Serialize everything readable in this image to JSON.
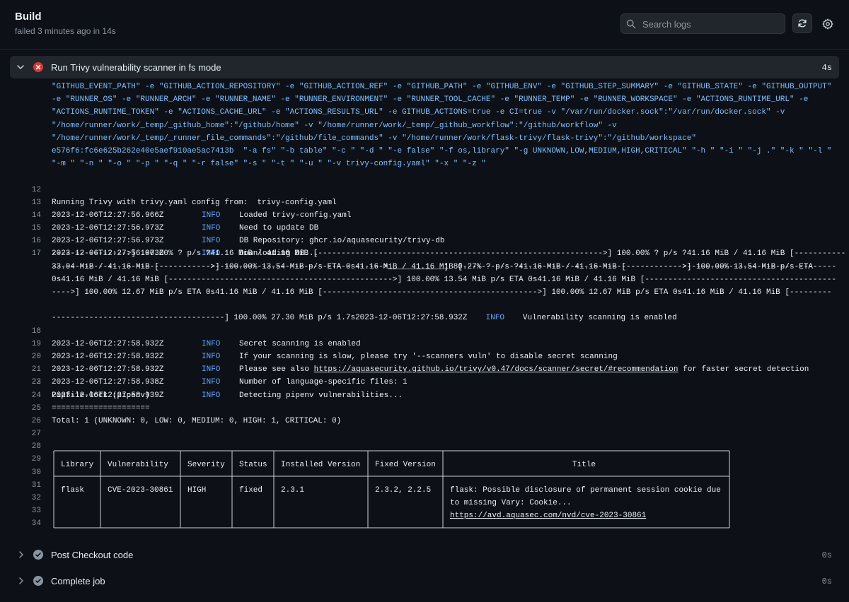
{
  "header": {
    "title": "Build",
    "subtitle": "failed 3 minutes ago in 14s",
    "search_placeholder": "Search logs"
  },
  "icons": {
    "search": "search-icon",
    "refresh": "refresh-icon",
    "settings": "gear-icon",
    "failed": "x-circle-icon",
    "success": "check-circle-icon"
  },
  "colors": {
    "failed": "#da3633",
    "success": "#8b949e",
    "info": "#58a6ff",
    "env": "#79c0ff"
  },
  "active_step": {
    "name": "Run Trivy vulnerability scanner in fs mode",
    "duration": "4s",
    "status": "failed"
  },
  "env_lines": [
    "\"GITHUB_EVENT_PATH\" -e \"GITHUB_ACTION_REPOSITORY\" -e \"GITHUB_ACTION_REF\" -e \"GITHUB_PATH\" -e \"GITHUB_ENV\" -e \"GITHUB_STEP_SUMMARY\" -e \"GITHUB_STATE\" -e \"GITHUB_OUTPUT\"",
    "-e \"RUNNER_OS\" -e \"RUNNER_ARCH\" -e \"RUNNER_NAME\" -e \"RUNNER_ENVIRONMENT\" -e \"RUNNER_TOOL_CACHE\" -e \"RUNNER_TEMP\" -e \"RUNNER_WORKSPACE\" -e \"ACTIONS_RUNTIME_URL\" -e",
    "\"ACTIONS_RUNTIME_TOKEN\" -e \"ACTIONS_CACHE_URL\" -e \"ACTIONS_RESULTS_URL\" -e GITHUB_ACTIONS=true -e CI=true -v \"/var/run/docker.sock\":\"/var/run/docker.sock\" -v",
    "\"/home/runner/work/_temp/_github_home\":\"/github/home\" -v \"/home/runner/work/_temp/_github_workflow\":\"/github/workflow\" -v",
    "\"/home/runner/work/_temp/_runner_file_commands\":\"/github/file_commands\" -v \"/home/runner/work/flask-trivy/flask-trivy\":\"/github/workspace\"",
    "e576f6:fc6e625b262e40e5aef910ae5ac7413b  \"-a fs\" \"-b table\" \"-c \" \"-d \" \"-e false\" \"-f os,library\" \"-g UNKNOWN,LOW,MEDIUM,HIGH,CRITICAL\" \"-h \" \"-i \" \"-j .\" \"-k \" \"-l \"",
    "\"-m \" \"-n \" \"-o \" \"-p \" \"-q \" \"-r false\" \"-s \" \"-t \" \"-u \" \"-v trivy-config.yaml\" \"-x \" \"-z \""
  ],
  "lines": [
    {
      "n": "12",
      "text": "Running Trivy with trivy.yaml config from:  trivy-config.yaml"
    },
    {
      "n": "13",
      "ts": "2023-12-06T12:27:56.966Z",
      "level": "INFO",
      "msg": "Loaded trivy-config.yaml"
    },
    {
      "n": "14",
      "ts": "2023-12-06T12:27:56.973Z",
      "level": "INFO",
      "msg": "Need to update DB"
    },
    {
      "n": "15",
      "ts": "2023-12-06T12:27:56.973Z",
      "level": "INFO",
      "msg": "DB Repository: ghcr.io/aquasecurity/trivy-db"
    },
    {
      "n": "16",
      "ts": "2023-12-06T12:27:56.973Z",
      "level": "INFO",
      "msg": "Downloading DB..."
    }
  ],
  "progress_line": {
    "n": "17",
    "rows": [
      "33.04 MiB / 41.16 MiB [------------------------------------------------>____________] 80.27% ? p/s ?41.16 MiB / 41.16 MiB [---------------------------------------------",
      "---------------->] 100.00% ? p/s ?41.16 MiB / 41.16 MiB [------------------------------------------------------------->] 100.00% ? p/s ?41.16 MiB / 41.16 MiB [-----------",
      "---------------------------------->] 100.00% 13.54 MiB p/s ETA 0s41.16 MiB / 41.16 MiB [----------------------------------------------->] 100.00% 13.54 MiB p/s ETA",
      "0s41.16 MiB / 41.16 MiB [------------------------------------------------>] 100.00% 13.54 MiB p/s ETA 0s41.16 MiB / 41.16 MiB [-----------------------------------------",
      "---->] 100.00% 12.67 MiB p/s ETA 0s41.16 MiB / 41.16 MiB [---------------------------------------------->] 100.00% 12.67 MiB p/s ETA 0s41.16 MiB / 41.16 MiB [---------",
      "-------------------------------------] 100.00% 27.30 MiB p/s 1.7s"
    ],
    "tail_ts": "2023-12-06T12:27:58.932Z",
    "tail_level": "INFO",
    "tail_msg": "Vulnerability scanning is enabled"
  },
  "lines2": [
    {
      "n": "18",
      "ts": "2023-12-06T12:27:58.932Z",
      "level": "INFO",
      "msg": "Secret scanning is enabled"
    },
    {
      "n": "19",
      "ts": "2023-12-06T12:27:58.932Z",
      "level": "INFO",
      "msg": "If your scanning is slow, please try '--scanners vuln' to disable secret scanning"
    },
    {
      "n": "20",
      "ts": "2023-12-06T12:27:58.932Z",
      "level": "INFO",
      "msg_pre": "Please see also ",
      "link": "https://aquasecurity.github.io/trivy/v0.47/docs/scanner/secret/#recommendation",
      "msg_post": " for faster secret detection"
    },
    {
      "n": "21",
      "ts": "2023-12-06T12:27:58.938Z",
      "level": "INFO",
      "msg": "Number of language-specific files: 1"
    },
    {
      "n": "22",
      "ts": "2023-12-06T12:27:58.939Z",
      "level": "INFO",
      "msg": "Detecting pipenv vulnerabilities..."
    }
  ],
  "plain_lines": [
    {
      "n": "23",
      "text": ""
    },
    {
      "n": "24",
      "text": "Pipfile.lock (pipenv)"
    },
    {
      "n": "25",
      "text": "====================="
    },
    {
      "n": "26",
      "text": "Total: 1 (UNKNOWN: 0, LOW: 0, MEDIUM: 0, HIGH: 1, CRITICAL: 0)"
    },
    {
      "n": "27",
      "text": ""
    }
  ],
  "table_line_numbers": [
    "28",
    "29",
    "30",
    "31",
    "32",
    "33",
    "34"
  ],
  "vuln_table": {
    "headers": [
      "Library",
      "Vulnerability",
      "Severity",
      "Status",
      "Installed Version",
      "Fixed Version",
      "Title"
    ],
    "row": {
      "library": "flask",
      "vulnerability": "CVE-2023-30861",
      "severity": "HIGH",
      "status": "fixed",
      "installed": "2.3.1",
      "fixed": "2.3.2, 2.2.5",
      "title_lines": [
        "flask: Possible disclosure of permanent session cookie due",
        "to missing Vary: Cookie..."
      ],
      "title_link": "https://avd.aquasec.com/nvd/cve-2023-30861"
    }
  },
  "other_steps": [
    {
      "name": "Post Checkout code",
      "duration": "0s",
      "status": "success"
    },
    {
      "name": "Complete job",
      "duration": "0s",
      "status": "success"
    }
  ]
}
